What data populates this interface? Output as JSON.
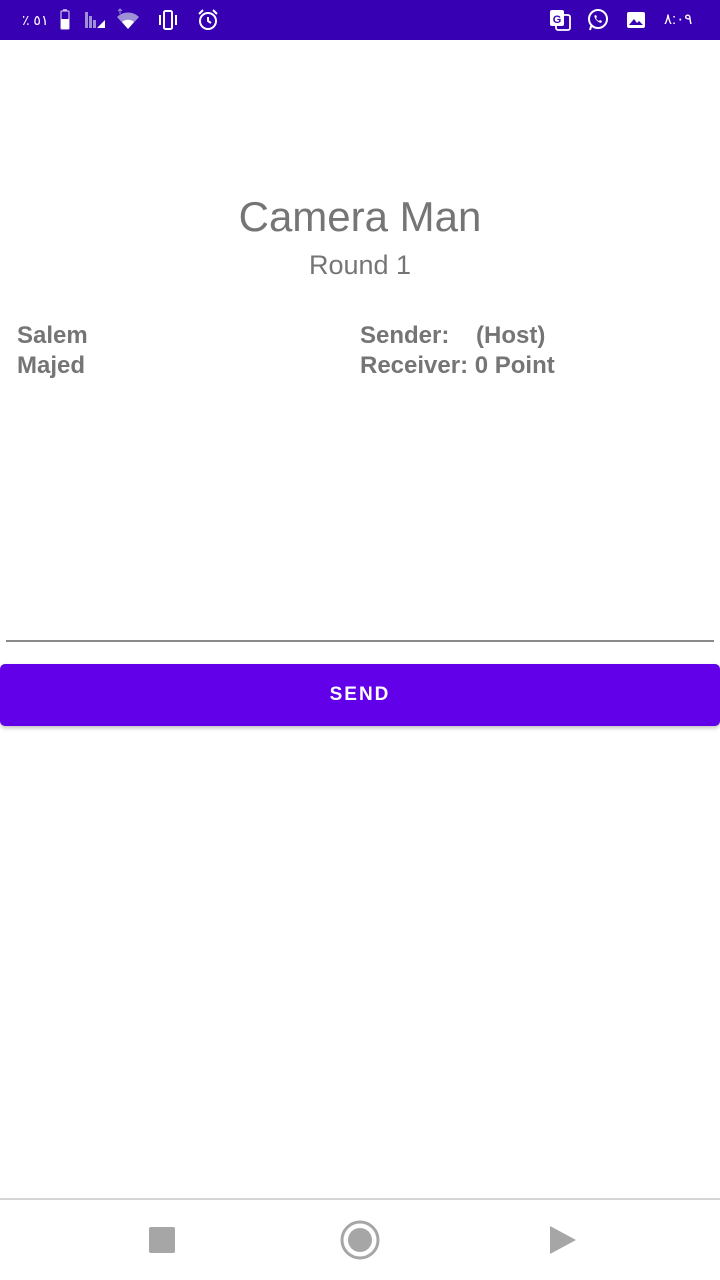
{
  "status_bar": {
    "battery_text": "٪ ٥١",
    "time": "٨:٠٩",
    "icons": [
      "battery-icon",
      "signal-icon",
      "wifi-icon",
      "vibrate-icon",
      "alarm-icon",
      "translate-icon",
      "whatsapp-icon",
      "gallery-icon"
    ],
    "background": "#3700b3"
  },
  "game": {
    "title": "Camera Man",
    "round": "Round 1"
  },
  "players": {
    "name_1": "Salem",
    "name_2": "Majed",
    "sender_label": "Sender:    (Host)",
    "receiver_label": "Receiver: 0 Point"
  },
  "input": {
    "value": "",
    "placeholder": ""
  },
  "send_button": {
    "label": "SEND",
    "color": "#6200ea"
  },
  "nav_bar": {
    "icons": [
      "recents-icon",
      "home-icon",
      "back-icon"
    ]
  }
}
